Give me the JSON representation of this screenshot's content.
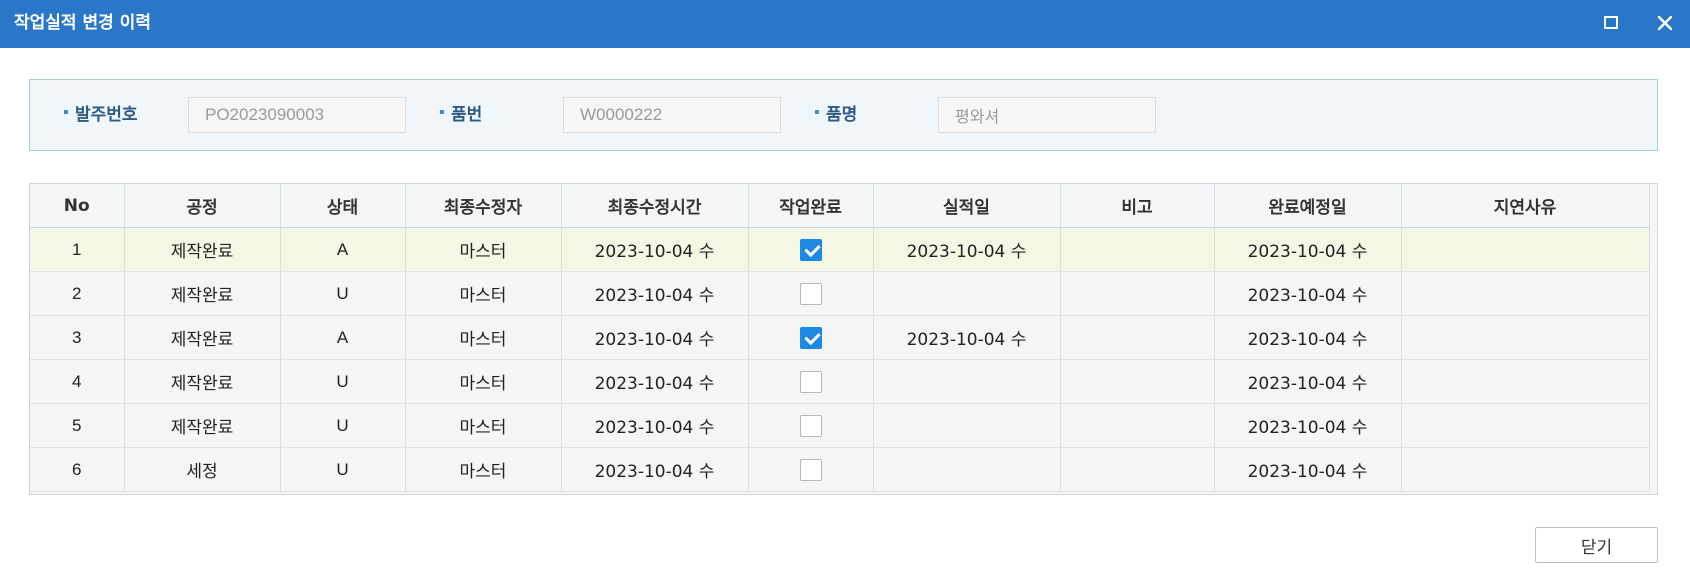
{
  "window": {
    "title": "작업실적 변경 이력",
    "maximize_icon": "maximize-icon",
    "close_icon": "close-icon",
    "titlebar_color": "#2a76c9"
  },
  "search": {
    "order_no_label": "발주번호",
    "order_no_value": "PO2023090003",
    "part_no_label": "품번",
    "part_no_value": "W0000222",
    "part_name_label": "품명",
    "part_name_value": "평와셔"
  },
  "grid": {
    "columns": [
      "No",
      "공정",
      "상태",
      "최종수정자",
      "최종수정시간",
      "작업완료",
      "실적일",
      "비고",
      "완료예정일",
      "지연사유"
    ],
    "rows": [
      {
        "no": "1",
        "process": "제작완료",
        "status": "A",
        "modifier": "마스터",
        "modified_at": "2023-10-04 수",
        "done": true,
        "result_date": "2023-10-04 수",
        "note": "",
        "due_date": "2023-10-04 수",
        "delay_reason": ""
      },
      {
        "no": "2",
        "process": "제작완료",
        "status": "U",
        "modifier": "마스터",
        "modified_at": "2023-10-04 수",
        "done": false,
        "result_date": "",
        "note": "",
        "due_date": "2023-10-04 수",
        "delay_reason": ""
      },
      {
        "no": "3",
        "process": "제작완료",
        "status": "A",
        "modifier": "마스터",
        "modified_at": "2023-10-04 수",
        "done": true,
        "result_date": "2023-10-04 수",
        "note": "",
        "due_date": "2023-10-04 수",
        "delay_reason": ""
      },
      {
        "no": "4",
        "process": "제작완료",
        "status": "U",
        "modifier": "마스터",
        "modified_at": "2023-10-04 수",
        "done": false,
        "result_date": "",
        "note": "",
        "due_date": "2023-10-04 수",
        "delay_reason": ""
      },
      {
        "no": "5",
        "process": "제작완료",
        "status": "U",
        "modifier": "마스터",
        "modified_at": "2023-10-04 수",
        "done": false,
        "result_date": "",
        "note": "",
        "due_date": "2023-10-04 수",
        "delay_reason": ""
      },
      {
        "no": "6",
        "process": "세정",
        "status": "U",
        "modifier": "마스터",
        "modified_at": "2023-10-04 수",
        "done": false,
        "result_date": "",
        "note": "",
        "due_date": "2023-10-04 수",
        "delay_reason": ""
      }
    ]
  },
  "footer": {
    "close_label": "닫기"
  }
}
